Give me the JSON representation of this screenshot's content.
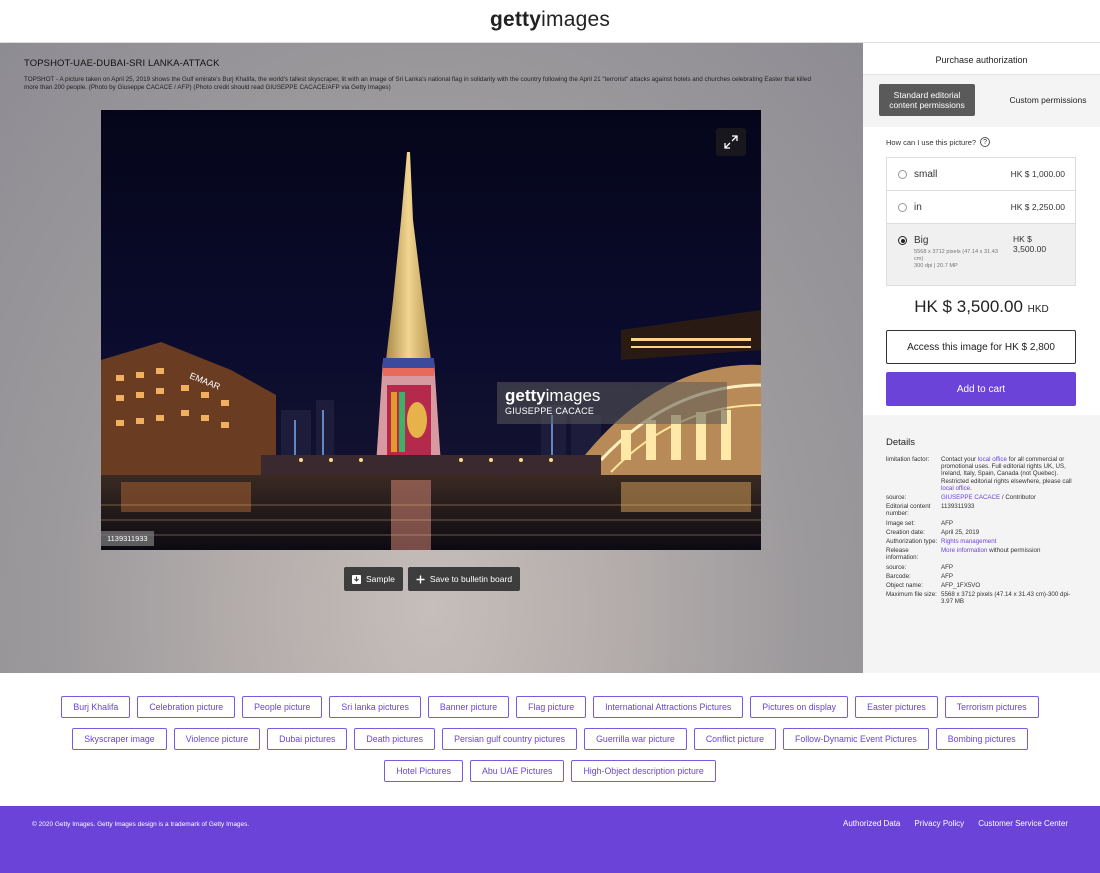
{
  "header": {
    "logo_bold": "getty",
    "logo_light": "images"
  },
  "image": {
    "title": "TOPSHOT-UAE-DUBAI-SRI LANKA-ATTACK",
    "caption": "TOPSHOT - A picture taken on April 25, 2019 shows the Gulf emirate's Burj Khalifa, the world's tallest skyscraper, lit with an image of Sri Lanka's national flag in solidarity with the country following the April 21 \"terrorist\" attacks against hotels and churches celebrating Easter that killed more than 200 people. (Photo by Giuseppe CACACE / AFP) (Photo credit should read GIUSEPPE CACACE/AFP via Getty Images)",
    "watermark_bold": "getty",
    "watermark_light": "images",
    "watermark_credit": "GIUSEPPE CACACE",
    "id_label": "1139311933",
    "sign_text": "EMAAR",
    "icons": {
      "expand": "expand-icon"
    }
  },
  "actions": {
    "sample_label": "Sample",
    "save_label": "Save to bulletin board"
  },
  "purchase": {
    "title": "Purchase authorization",
    "tab_standard": "Standard editorial content permissions",
    "tab_custom": "Custom permissions",
    "question": "How can I use this picture?",
    "options": [
      {
        "name": "small",
        "price": "HK $ 1,000.00"
      },
      {
        "name": "in",
        "price": "HK $ 2,250.00"
      },
      {
        "name": "Big",
        "price": "HK $ 3,500.00",
        "spec_1": "5568 x 3712 pixels (47.14 x 31.43 cm)",
        "spec_2": "300 dpi | 20.7 MP"
      }
    ],
    "selected_option": "Big",
    "total": "HK $ 3,500.00",
    "total_currency": "HKD",
    "access_label": "Access this image for HK $ 2,800",
    "cart_label": "Add to cart"
  },
  "details": {
    "title": "Details",
    "limitation_key": "limitation factor:",
    "limitation_a": "Contact your ",
    "limitation_link1": "local office",
    "limitation_b": " for all commercial or promotional uses. Full editorial rights UK, US, Ireland, Italy, Spain, Canada (not Quebec). Restricted editorial rights elsewhere, please call ",
    "limitation_link2": "local office",
    "limitation_c": ".",
    "source_key": "source:",
    "source_link": "GIUSEPPE CACACE",
    "source_rest": " / Contributor",
    "editorial_key": "Editorial content number:",
    "editorial_val": "1139311933",
    "imageset_key": "Image set:",
    "imageset_val": "AFP",
    "creation_key": "Creation date:",
    "creation_val": "April 25, 2019",
    "auth_key": "Authorization type:",
    "auth_val": "Rights management",
    "release_key": "Release information:",
    "release_link": "More information",
    "release_rest": " without permission",
    "source2_key": "source:",
    "source2_val": "AFP",
    "barcode_key": "Barcode:",
    "barcode_val": "AFP",
    "object_key": "Object name:",
    "object_val": "AFP_1FX5VO",
    "maxfile_key": "Maximum file size:",
    "maxfile_val": "5568 x 3712 pixels (47.14 x 31.43 cm)-300 dpi-3.97 MB"
  },
  "tags": {
    "row1": [
      "Burj Khalifa",
      "Celebration picture",
      "People picture",
      "Sri lanka pictures",
      "Banner picture",
      "Flag picture",
      "International Attractions Pictures",
      "Pictures on display",
      "Easter pictures",
      "Terrorism pictures"
    ],
    "row2": [
      "Skyscraper image",
      "Violence picture",
      "Dubai pictures",
      "Death pictures",
      "Persian gulf country pictures",
      "Guerrilla war picture",
      "Conflict picture",
      "Follow-Dynamic Event Pictures",
      "Bombing pictures"
    ],
    "row3": [
      "Hotel Pictures",
      "Abu UAE Pictures",
      "High-Object description picture"
    ]
  },
  "footer": {
    "copyright": "© 2020 Getty Images. Getty Images design is a trademark of Getty Images.",
    "links": [
      "Authorized Data",
      "Privacy Policy",
      "Customer Service Center"
    ]
  },
  "colors": {
    "accent": "#6c43d8",
    "dark_button": "#3d3d3d",
    "panel_bg": "#f4f4f4"
  }
}
